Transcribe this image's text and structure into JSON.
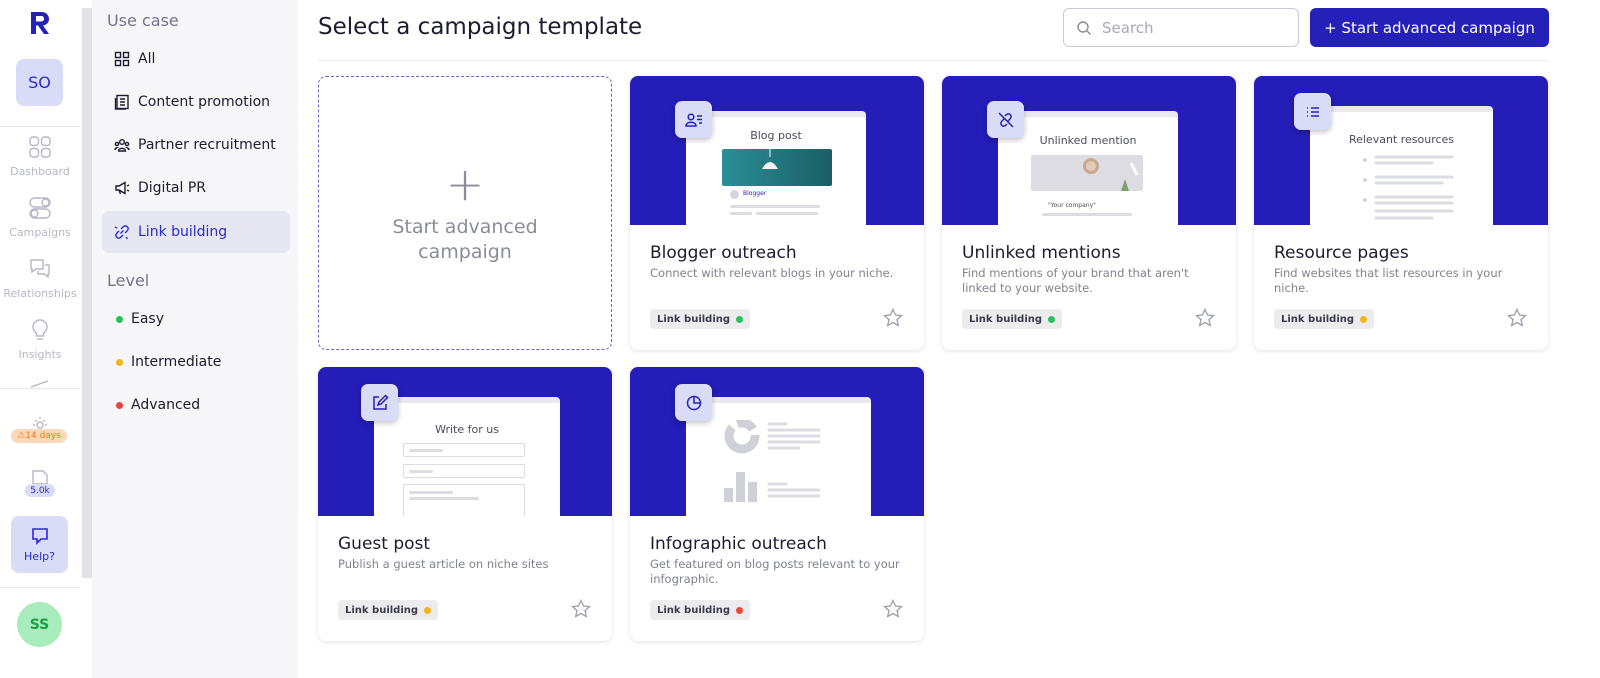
{
  "rail": {
    "org_initials": "SO",
    "items": [
      {
        "label": "Dashboard",
        "icon": "grid-icon"
      },
      {
        "label": "Campaigns",
        "icon": "toggles-icon"
      },
      {
        "label": "Relationships",
        "icon": "chat-icon"
      },
      {
        "label": "Insights",
        "icon": "lightbulb-icon"
      }
    ],
    "warning_badge": "⚠14 days",
    "credits_badge": "5.0k",
    "help_label": "Help?",
    "user_initials": "SS"
  },
  "filters": {
    "use_case_heading": "Use case",
    "use_cases": [
      {
        "label": "All",
        "icon": "grid-icon"
      },
      {
        "label": "Content promotion",
        "icon": "document-icon"
      },
      {
        "label": "Partner recruitment",
        "icon": "people-icon"
      },
      {
        "label": "Digital PR",
        "icon": "megaphone-icon"
      },
      {
        "label": "Link building",
        "icon": "link-icon",
        "active": true
      }
    ],
    "level_heading": "Level",
    "levels": [
      {
        "label": "Easy",
        "color": "#27c25a"
      },
      {
        "label": "Intermediate",
        "color": "#f2b41c"
      },
      {
        "label": "Advanced",
        "color": "#e8473b"
      }
    ]
  },
  "header": {
    "title": "Select a campaign template",
    "search_placeholder": "Search",
    "search_value": "",
    "cta_label": "+ Start advanced campaign"
  },
  "colors": {
    "brand": "#2520b8",
    "easy": "#27c25a",
    "intermediate": "#f2b41c",
    "advanced": "#e8473b"
  },
  "blank_card": {
    "label": "Start advanced campaign"
  },
  "cards": [
    {
      "title": "Blogger outreach",
      "desc": "Connect with relevant blogs in your niche.",
      "tag": "Link building",
      "level_color": "#27c25a",
      "mock_title": "Blog post",
      "mock_author": "Blogger",
      "icon": "contact-list-icon"
    },
    {
      "title": "Unlinked mentions",
      "desc": "Find mentions of your brand that aren't linked to your website.",
      "tag": "Link building",
      "level_color": "#27c25a",
      "mock_title": "Unlinked mention",
      "mock_quote": "\"Your company\"",
      "icon": "unlink-icon"
    },
    {
      "title": "Resource pages",
      "desc": "Find websites that list resources in your niche.",
      "tag": "Link building",
      "level_color": "#f2b41c",
      "mock_title": "Relevant resources",
      "icon": "list-icon"
    },
    {
      "title": "Guest post",
      "desc": "Publish a guest article on niche sites",
      "tag": "Link building",
      "level_color": "#f2b41c",
      "mock_title": "Write for us",
      "icon": "edit-icon"
    },
    {
      "title": "Infographic outreach",
      "desc": "Get featured on blog posts relevant to your infographic.",
      "tag": "Link building",
      "level_color": "#e8473b",
      "mock_title": "",
      "icon": "pie-chart-icon"
    }
  ]
}
